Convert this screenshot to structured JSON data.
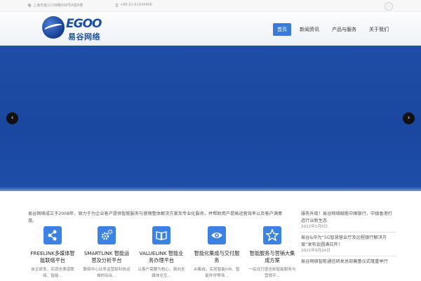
{
  "topbar": {
    "address": "上海市金沙江西路568号A座6楼",
    "phone": "+86-21 61934408"
  },
  "logo": {
    "brand": "EGOO",
    "cn_name": "易谷网络"
  },
  "nav": {
    "items": [
      "首页",
      "新闻资讯",
      "产品与服务",
      "关于我们"
    ]
  },
  "banner": {
    "prev": "‹",
    "next": "›"
  },
  "intro": {
    "text": "易谷网络成立于2008年，致力于为企业客户提供智能服务与营销整体解决方案及专业化服务，并帮助用户提高运营效率以及客户满意度。"
  },
  "services": [
    {
      "title": "FREELINK多媒体智能联络平台",
      "desc": "自主研发，实现全渠道联络、智能..."
    },
    {
      "title": "SMARTLINK 智能运营及分析平台",
      "desc": "联络中心业务运营和科技运维的综合..."
    },
    {
      "title": "VALUELINK 智能业务办理平台",
      "desc": "以客户需要为核心，面向全媒体交互..."
    },
    {
      "title": "智能化集成与交付服务",
      "desc": "AI集成，实现智能IVR、智能外呼等场..."
    },
    {
      "title": "智能服务与营销大集成方案",
      "desc": "一站式打造全新智能服务与营销平..."
    }
  ],
  "news": [
    {
      "title": "服务升级！易谷网络赋能中国银行，中银香港打造行业新生态",
      "date": "2022年1月5日"
    },
    {
      "title": "易谷&华为“5G智慧营业厅及远程银行解决方案”发布会圆满召开！",
      "date": "2021年9月24日"
    },
    {
      "title": "易谷网络智能通信研发总部奠基仪式隆重举行",
      "date": ""
    }
  ]
}
